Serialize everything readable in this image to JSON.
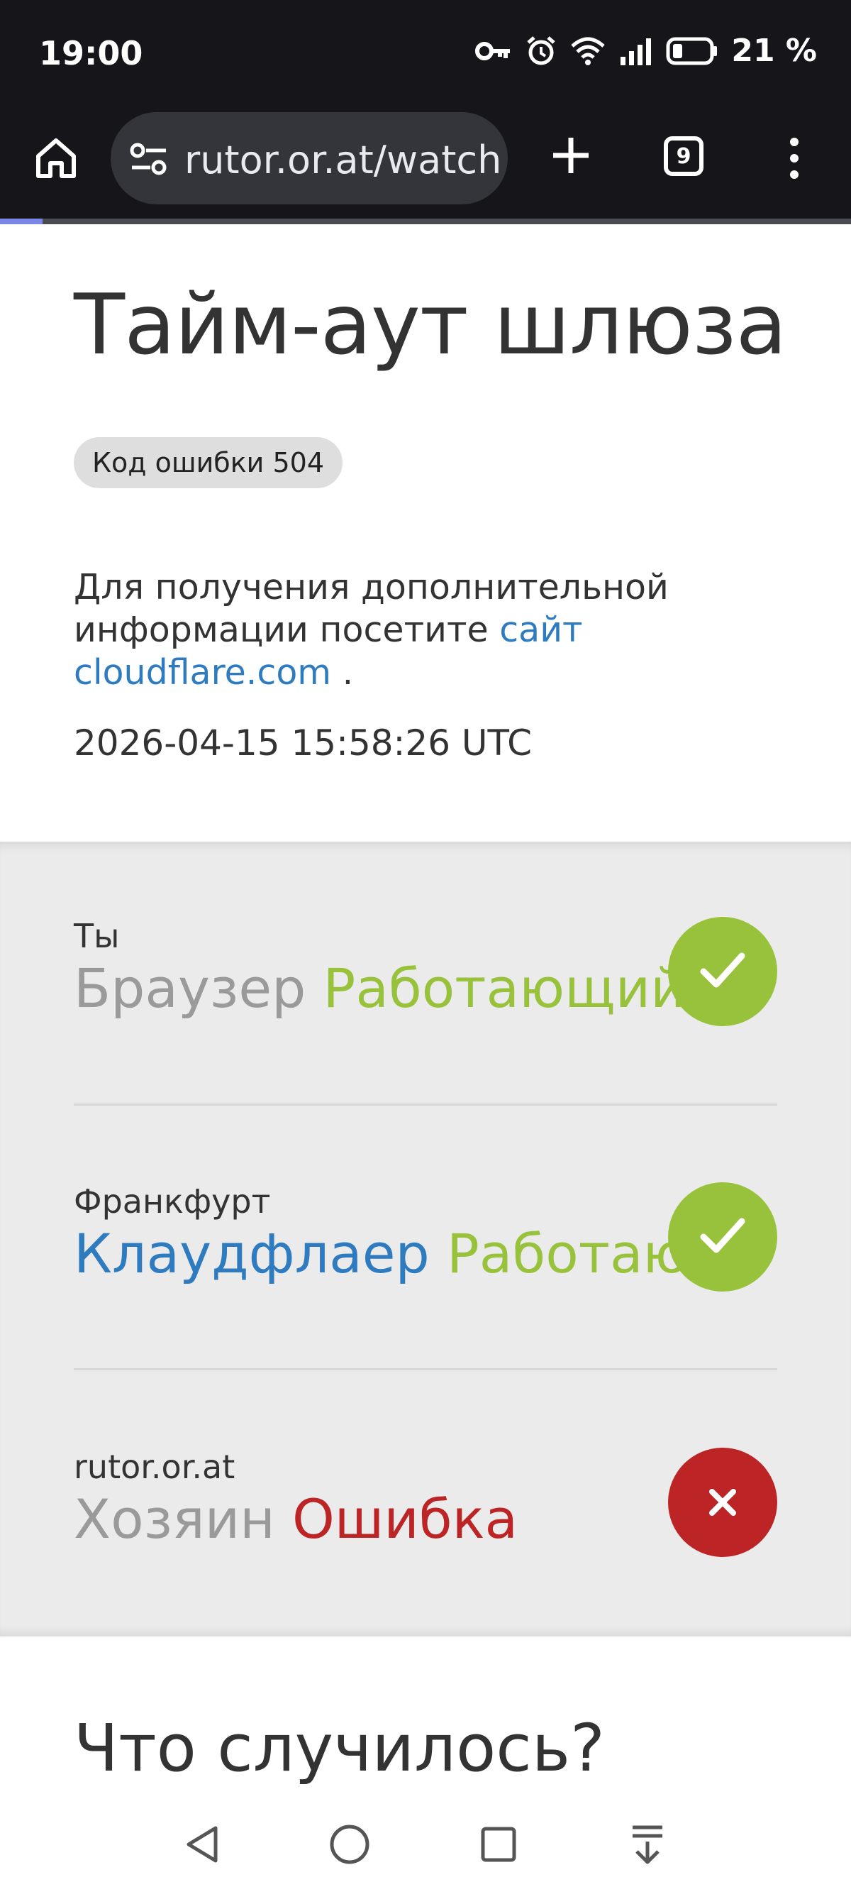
{
  "status_bar": {
    "time": "19:00",
    "battery_percent": "21 %",
    "icons": [
      "key-icon",
      "alarm-icon",
      "wifi-icon",
      "signal-icon",
      "battery-icon"
    ]
  },
  "browser": {
    "url": "rutor.or.at/watch",
    "tab_count": "9",
    "icons": [
      "home-icon",
      "site-settings-icon",
      "new-tab-icon",
      "tabs-icon",
      "menu-icon"
    ]
  },
  "page": {
    "title": "Тайм-аут шлюза",
    "error_badge": "Код ошибки 504",
    "info_text": "Для получения дополнительной информации посетите",
    "info_link": "сайт cloudflare.com",
    "info_suffix": " .",
    "timestamp": "2026-04-15 15:58:26 UTC",
    "what_happened": "Что случилось?"
  },
  "status_rows": [
    {
      "label": "Ты",
      "name": "Браузер",
      "status": "Работающий",
      "state": "ok",
      "icon": "check-icon"
    },
    {
      "label": "Франкфурт",
      "name": "Клаудфлаер",
      "status": "Работающий",
      "state": "ok",
      "icon": "check-icon"
    },
    {
      "label": "rutor.or.at",
      "name": "Хозяин",
      "status": "Ошибка",
      "state": "error",
      "icon": "x-icon"
    }
  ],
  "nav_bar": {
    "icons": [
      "back-icon",
      "home-circle-icon",
      "recents-icon",
      "collapse-icon"
    ]
  },
  "colors": {
    "ok": "#99c23c",
    "error": "#bd2426",
    "link": "#2f7bbf",
    "toolbar_bg": "#16161a"
  }
}
